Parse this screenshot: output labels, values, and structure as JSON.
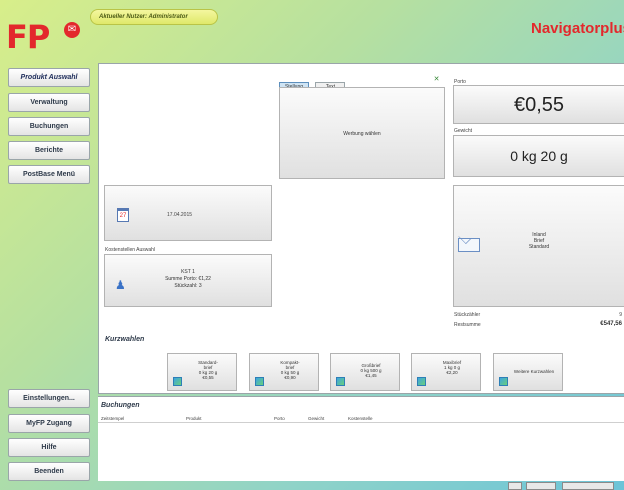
{
  "header": {
    "logo_text": "FP",
    "user_label": "Aktueller Nutzer: Administrator",
    "app_title": "Navigatorplus"
  },
  "sidebar": {
    "items": [
      {
        "label": "Produkt Auswahl"
      },
      {
        "label": "Verwaltung"
      },
      {
        "label": "Buchungen"
      },
      {
        "label": "Berichte"
      },
      {
        "label": "PostBase Menü"
      }
    ],
    "bottom_items": [
      {
        "label": "Einstellungen..."
      },
      {
        "label": "MyFP Zugang"
      },
      {
        "label": "Hilfe"
      },
      {
        "label": "Beenden"
      }
    ]
  },
  "main": {
    "tabs": [
      {
        "label": "Stellung"
      },
      {
        "label": "Text"
      }
    ],
    "werbung_text": "Werbung wählen",
    "date": "17.04.2015",
    "kostenstellen_label": "Kostenstellen Auswahl",
    "kostenstelle": {
      "name": "KST 1",
      "summe": "Summe Porto: €1,22",
      "stueckzahl": "Stückzahl: 3"
    },
    "porto_label": "Porto",
    "porto_value": "€0,55",
    "gewicht_label": "Gewicht",
    "gewicht_value": "0 kg 20 g",
    "product": {
      "line1": "Inland",
      "line2": "Brief",
      "line3": "Standard"
    },
    "stueckzaehler_label": "Stückzähler",
    "stueckzaehler_value": "9",
    "restsumme_label": "Restsumme",
    "restsumme_value": "€547,56"
  },
  "kurzwahlen": {
    "title": "Kurzwahlen",
    "items": [
      {
        "line1": "Standard-",
        "line2": "brief",
        "line3": "0 kg 20 g",
        "line4": "€0,55"
      },
      {
        "line1": "Kompakt-",
        "line2": "brief",
        "line3": "0 kg 50 g",
        "line4": "€0,90"
      },
      {
        "line1": "Großbrief",
        "line2": "",
        "line3": "0 kg 500 g",
        "line4": "€1,45"
      },
      {
        "line1": "Maxibrief",
        "line2": "",
        "line3": "1 kg 0 g",
        "line4": "€2,20"
      },
      {
        "line1": "Weitere Kurzwahlen",
        "line2": "",
        "line3": "",
        "line4": ""
      }
    ]
  },
  "buchungen": {
    "title": "Buchungen",
    "columns": [
      "Zeitstempel",
      "Produkt",
      "Porto",
      "Gewicht",
      "Kostenstelle"
    ]
  },
  "colors": {
    "brand_red": "#e3282c",
    "accent_blue": "#3a72c6"
  }
}
